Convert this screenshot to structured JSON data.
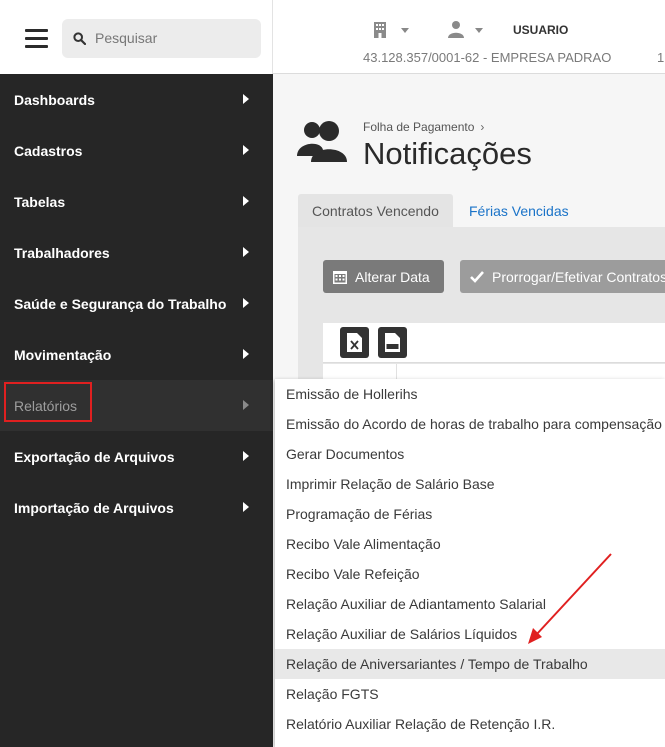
{
  "search": {
    "placeholder": "Pesquisar"
  },
  "sidebar": {
    "items": [
      {
        "label": "Dashboards"
      },
      {
        "label": "Cadastros"
      },
      {
        "label": "Tabelas"
      },
      {
        "label": "Trabalhadores"
      },
      {
        "label": "Saúde e Segurança do Trabalho"
      },
      {
        "label": "Movimentação"
      },
      {
        "label": "Relatórios",
        "active": true
      },
      {
        "label": "Exportação de Arquivos"
      },
      {
        "label": "Importação de Arquivos"
      }
    ]
  },
  "header": {
    "username": "USUARIO",
    "company": "43.128.357/0001-62 - EMPRESA PADRAO",
    "company_extra": "1"
  },
  "page": {
    "breadcrumb": "Folha de Pagamento",
    "title": "Notificações"
  },
  "tabs": [
    {
      "label": "Contratos Vencendo",
      "active": true
    },
    {
      "label": "Férias Vencidas",
      "active": false
    }
  ],
  "toolbar": {
    "change_date_label": "Alterar Data",
    "extend_label": "Prorrogar/Efetivar Contratos"
  },
  "submenu": {
    "items": [
      {
        "label": "Emissão de Hollerihs"
      },
      {
        "label": "Emissão do Acordo de horas de trabalho para compensação"
      },
      {
        "label": "Gerar Documentos"
      },
      {
        "label": "Imprimir Relação de Salário Base"
      },
      {
        "label": "Programação de Férias"
      },
      {
        "label": "Recibo Vale Alimentação"
      },
      {
        "label": "Recibo Vale Refeição"
      },
      {
        "label": "Relação Auxiliar de Adiantamento Salarial"
      },
      {
        "label": "Relação Auxiliar de Salários Líquidos"
      },
      {
        "label": "Relação de Aniversariantes / Tempo de Trabalho",
        "highlighted": true
      },
      {
        "label": "Relação FGTS"
      },
      {
        "label": "Relatório Auxiliar Relação de Retenção I.R."
      }
    ]
  },
  "colors": {
    "sidebar_bg": "#262626",
    "accent_link": "#1a73c8",
    "highlight_box": "#e02020",
    "arrow": "#e02020"
  }
}
